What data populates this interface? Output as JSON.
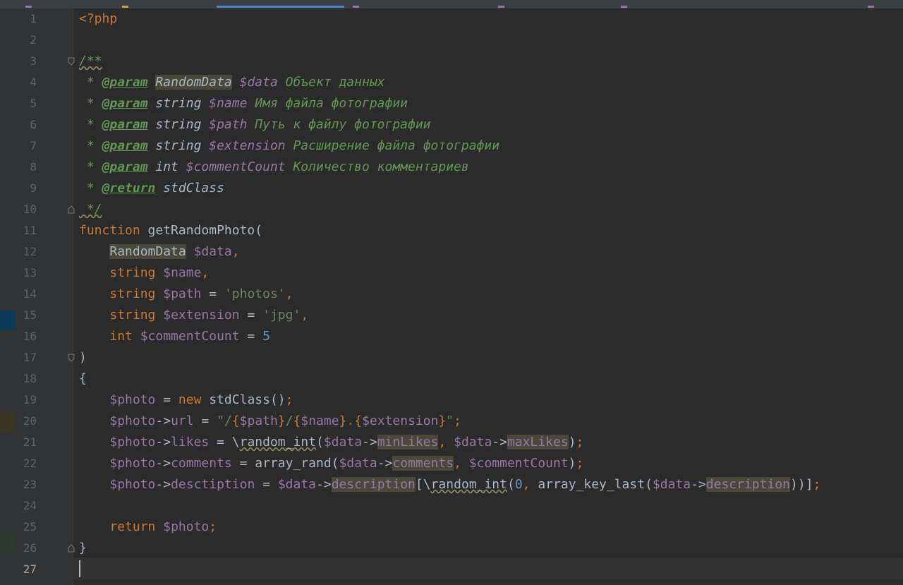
{
  "editor": {
    "language": "php",
    "current_line": 27,
    "line_numbers": [
      "1",
      "2",
      "3",
      "4",
      "5",
      "6",
      "7",
      "8",
      "9",
      "10",
      "11",
      "12",
      "13",
      "14",
      "15",
      "16",
      "17",
      "18",
      "19",
      "20",
      "21",
      "22",
      "23",
      "24",
      "25",
      "26",
      "27"
    ],
    "code": {
      "l1": "<?php",
      "l3_open": "/**",
      "l4": {
        "star": " * ",
        "tag": "@param",
        "type": "RandomData",
        "var": "$data",
        "desc": " Объект данных"
      },
      "l5": {
        "star": " * ",
        "tag": "@param",
        "type": " string ",
        "var": "$name",
        "desc": " Имя файла фотографии"
      },
      "l6": {
        "star": " * ",
        "tag": "@param",
        "type": " string ",
        "var": "$path",
        "desc": " Путь к файлу фотографии"
      },
      "l7": {
        "star": " * ",
        "tag": "@param",
        "type": " string ",
        "var": "$extension",
        "desc": " Расширение файла фотографии"
      },
      "l8": {
        "star": " * ",
        "tag": "@param",
        "type": " int ",
        "var": "$commentCount",
        "desc": " Количество комментариев"
      },
      "l9": {
        "star": " * ",
        "tag": "@return",
        "type": " stdClass"
      },
      "l10": " */",
      "l11": {
        "kw": "function",
        "name": " getRandomPhoto",
        "paren": "("
      },
      "l12": {
        "indent": "    ",
        "type": "RandomData",
        "var": " $data",
        "punct": ","
      },
      "l13": {
        "indent": "    ",
        "type": "string",
        "var": " $name",
        "punct": ","
      },
      "l14": {
        "indent": "    ",
        "type": "string",
        "var": " $path",
        "eq": " = ",
        "str": "'photos'",
        "punct": ","
      },
      "l15": {
        "indent": "    ",
        "type": "string",
        "var": " $extension",
        "eq": " = ",
        "str": "'jpg'",
        "punct": ","
      },
      "l16": {
        "indent": "    ",
        "type": "int",
        "var": " $commentCount",
        "eq": " = ",
        "num": "5"
      },
      "l17": ")",
      "l18": "{",
      "l19": {
        "indent": "    ",
        "var": "$photo",
        "eq": " = ",
        "kw": "new",
        "cls": " stdClass()",
        "semi": ";"
      },
      "l20": {
        "indent": "    ",
        "var": "$photo",
        "arrow": "->",
        "prop": "url",
        "eq": " = ",
        "q1": "\"/",
        "b1": "{",
        "v1": "$path",
        "b2": "}",
        "slash": "/",
        "b3": "{",
        "v2": "$name",
        "b4": "}",
        "dot": ".",
        "b5": "{",
        "v3": "$extension",
        "b6": "}",
        "q2": "\"",
        "semi": ";"
      },
      "l21": {
        "indent": "    ",
        "var": "$photo",
        "arrow": "->",
        "prop": "likes",
        "eq": " = ",
        "bs": "\\",
        "fn": "random_int",
        "open": "(",
        "v1": "$data",
        "a1": "->",
        "p1": "minLikes",
        "comma": ", ",
        "v2": "$data",
        "a2": "->",
        "p2": "maxLikes",
        "close": ")",
        "semi": ";"
      },
      "l22": {
        "indent": "    ",
        "var": "$photo",
        "arrow": "->",
        "prop": "comments",
        "eq": " = ",
        "fn": "array_rand",
        "open": "(",
        "v1": "$data",
        "a1": "->",
        "p1": "comments",
        "comma": ", ",
        "v2": "$commentCount",
        "close": ")",
        "semi": ";"
      },
      "l23": {
        "indent": "    ",
        "var": "$photo",
        "arrow": "->",
        "prop": "desctiption",
        "eq": " = ",
        "v1": "$data",
        "a1": "->",
        "p1": "description",
        "br": "[",
        "bs": "\\",
        "fn": "random_int",
        "open": "(",
        "num": "0",
        "comma": ", ",
        "fn2": "array_key_last",
        "open2": "(",
        "v2": "$data",
        "a2": "->",
        "p2": "description",
        "close": "))",
        "br2": "]",
        "semi": ";"
      },
      "l25": {
        "indent": "    ",
        "kw": "return",
        "var": " $photo",
        "semi": ";"
      },
      "l26": "}"
    }
  },
  "colors": {
    "background": "#2b2b2b",
    "gutter": "#313335",
    "keyword": "#cc7832",
    "variable": "#9876aa",
    "string": "#6a8759",
    "number": "#6897bb",
    "comment": "#629755",
    "plain": "#a9b7c6",
    "tab_active": "#4a88c7"
  }
}
